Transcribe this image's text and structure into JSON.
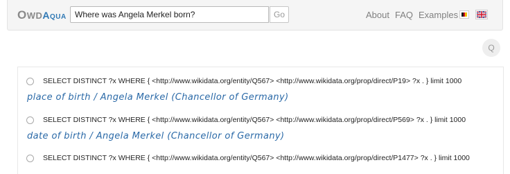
{
  "logo": {
    "o": "O",
    "wd": "WD",
    "aqua": "Aqua"
  },
  "search": {
    "value": "Where was Angela Merkel born?",
    "go_label": "Go"
  },
  "nav": {
    "about": "About",
    "faq": "FAQ",
    "examples": "Examples"
  },
  "flags": {
    "german": {
      "icon": "german-flag-icon",
      "colors": [
        "#1a1a1a",
        "#d40a1c",
        "#f0c10c"
      ]
    },
    "english": {
      "icon": "uk-flag-icon",
      "colors": [
        "#223b86",
        "#cf142b",
        "#ffffff"
      ]
    }
  },
  "query_button": {
    "label": "Q",
    "icon": "circle-button"
  },
  "results": [
    {
      "sparql": "SELECT DISTINCT ?x WHERE { <http://www.wikidata.org/entity/Q567> <http://www.wikidata.org/prop/direct/P19> ?x . } limit 1000",
      "interpretation": "place of birth / Angela Merkel (Chancellor of Germany)"
    },
    {
      "sparql": "SELECT DISTINCT ?x WHERE { <http://www.wikidata.org/entity/Q567> <http://www.wikidata.org/prop/direct/P569> ?x . } limit 1000",
      "interpretation": "date of birth / Angela Merkel (Chancellor of Germany)"
    },
    {
      "sparql": "SELECT DISTINCT ?x WHERE { <http://www.wikidata.org/entity/Q567> <http://www.wikidata.org/prop/direct/P1477> ?x . } limit 1000",
      "interpretation": ""
    }
  ],
  "colors": {
    "accent": "#2a69a7",
    "navbar_bg": "#f5f5f5"
  }
}
